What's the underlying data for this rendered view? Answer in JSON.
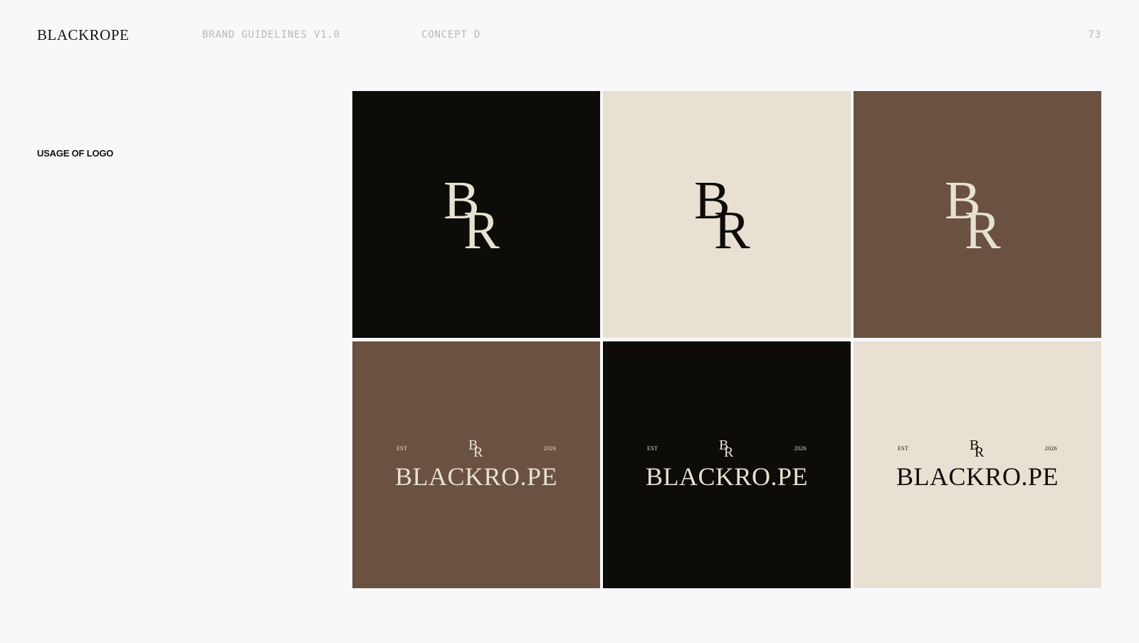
{
  "header": {
    "brand": "BLACKROPE",
    "guidelines": "BRAND GUIDELINES V1.0",
    "concept": "CONCEPT D",
    "page_number": "73"
  },
  "section": {
    "title": "USAGE OF LOGO"
  },
  "colors": {
    "black": "#0e0c09",
    "cream": "#e8e1d3",
    "brown": "#6b5240",
    "page_background": "#f8f8fa"
  },
  "monogram": {
    "b": "B",
    "r": "R"
  },
  "lockup": {
    "est": "EST",
    "year": "2026",
    "wordmark": "BLACKRO.PE"
  },
  "tiles": [
    {
      "variant": "monogram",
      "background": "#0e0c09",
      "foreground": "#e8e1d3"
    },
    {
      "variant": "monogram",
      "background": "#e8e1d3",
      "foreground": "#0e0c09"
    },
    {
      "variant": "monogram",
      "background": "#6b5240",
      "foreground": "#e8e1d3"
    },
    {
      "variant": "lockup",
      "background": "#6b5240",
      "foreground": "#e8e1d3"
    },
    {
      "variant": "lockup",
      "background": "#0e0c09",
      "foreground": "#e8e1d3"
    },
    {
      "variant": "lockup",
      "background": "#e8e1d3",
      "foreground": "#0e0c09"
    }
  ]
}
